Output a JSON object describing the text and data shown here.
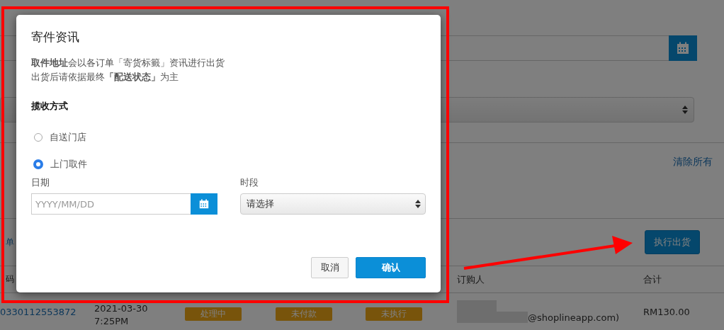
{
  "background": {
    "clear_all_link": "清除所有",
    "orders_link": "单",
    "ship_button": "执行出货",
    "columns": [
      "码",
      "订购人",
      "合计"
    ],
    "rows": [
      {
        "order_number": "0330112553872",
        "date": "2021-03-30",
        "time": "7:25PM",
        "badges": [
          "处理中",
          "未付款",
          "未执行"
        ],
        "email": "@shoplineapp.com)",
        "total": "RM130.00"
      }
    ]
  },
  "dialog": {
    "title": "寄件资讯",
    "notes": [
      "**取件地址**会以各订单「寄货标籤」资讯进行出货",
      "出货后请依据最终**「配送状态」**为主"
    ],
    "section_title": "揽收方式",
    "options": [
      {
        "label": "自送门店",
        "selected": false
      },
      {
        "label": "上门取件",
        "selected": true
      }
    ],
    "date_field": {
      "label": "日期",
      "placeholder": "YYYY/MM/DD"
    },
    "time_field": {
      "label": "时段",
      "value": "请选择"
    },
    "buttons": [
      {
        "label": "取消",
        "kind": "secondary"
      },
      {
        "label": "确认",
        "kind": "primary"
      }
    ]
  }
}
